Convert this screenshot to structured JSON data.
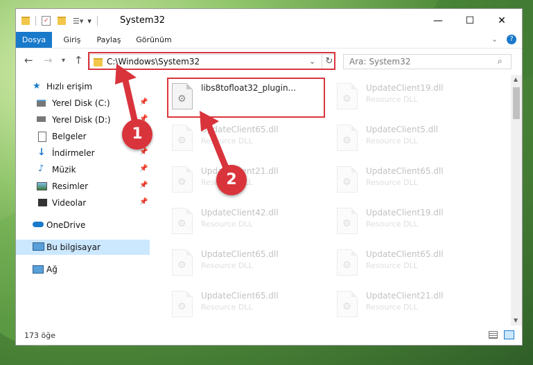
{
  "window": {
    "title": "System32"
  },
  "ribbon": {
    "tabs": [
      "Dosya",
      "Giriş",
      "Paylaş",
      "Görünüm"
    ]
  },
  "address": {
    "path": "C:\\Windows\\System32"
  },
  "search": {
    "placeholder": "Ara: System32"
  },
  "sidebar": {
    "quick_access": "Hızlı erişim",
    "items": [
      "Yerel Disk (C:)",
      "Yerel Disk (D:)",
      "Belgeler",
      "İndirmeler",
      "Müzik",
      "Resimler",
      "Videolar"
    ],
    "onedrive": "OneDrive",
    "this_pc": "Bu bilgisayar",
    "network": "Ağ"
  },
  "files": {
    "highlighted": {
      "name": "libs8tofloat32_plugin...",
      "type": ""
    },
    "col1": [
      {
        "name": "UpdateClient65.dll",
        "type": "Resource DLL"
      },
      {
        "name": "UpdateClient21.dll",
        "type": "Resource DLL"
      },
      {
        "name": "UpdateClient42.dll",
        "type": "Resource DLL"
      },
      {
        "name": "UpdateClient65.dll",
        "type": "Resource DLL"
      },
      {
        "name": "UpdateClient65.dll",
        "type": "Resource DLL"
      }
    ],
    "col2": [
      {
        "name": "UpdateClient19.dll",
        "type": "Resource DLL"
      },
      {
        "name": "UpdateClient5.dll",
        "type": "Resource DLL"
      },
      {
        "name": "UpdateClient65.dll",
        "type": "Resource DLL"
      },
      {
        "name": "UpdateClient19.dll",
        "type": "Resource DLL"
      },
      {
        "name": "UpdateClient65.dll",
        "type": "Resource DLL"
      },
      {
        "name": "UpdateClient21.dll",
        "type": "Resource DLL"
      }
    ]
  },
  "status": {
    "count": "173 öğe"
  },
  "annotations": {
    "step1": "1",
    "step2": "2"
  },
  "colors": {
    "accent": "#1979ca",
    "highlight": "#d9343c",
    "selected": "#cce8ff"
  }
}
